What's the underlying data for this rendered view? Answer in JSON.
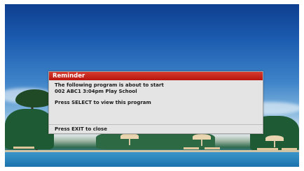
{
  "reminder": {
    "title": "Reminder",
    "line1": "The following program is about to start",
    "program": "002 ABC1 3:04pm Play School",
    "instruction": "Press SELECT to view this program",
    "footer": "Press EXIT to close"
  },
  "colors": {
    "title_bar": "#c8231a",
    "dialog_bg": "#e4e4e4"
  }
}
